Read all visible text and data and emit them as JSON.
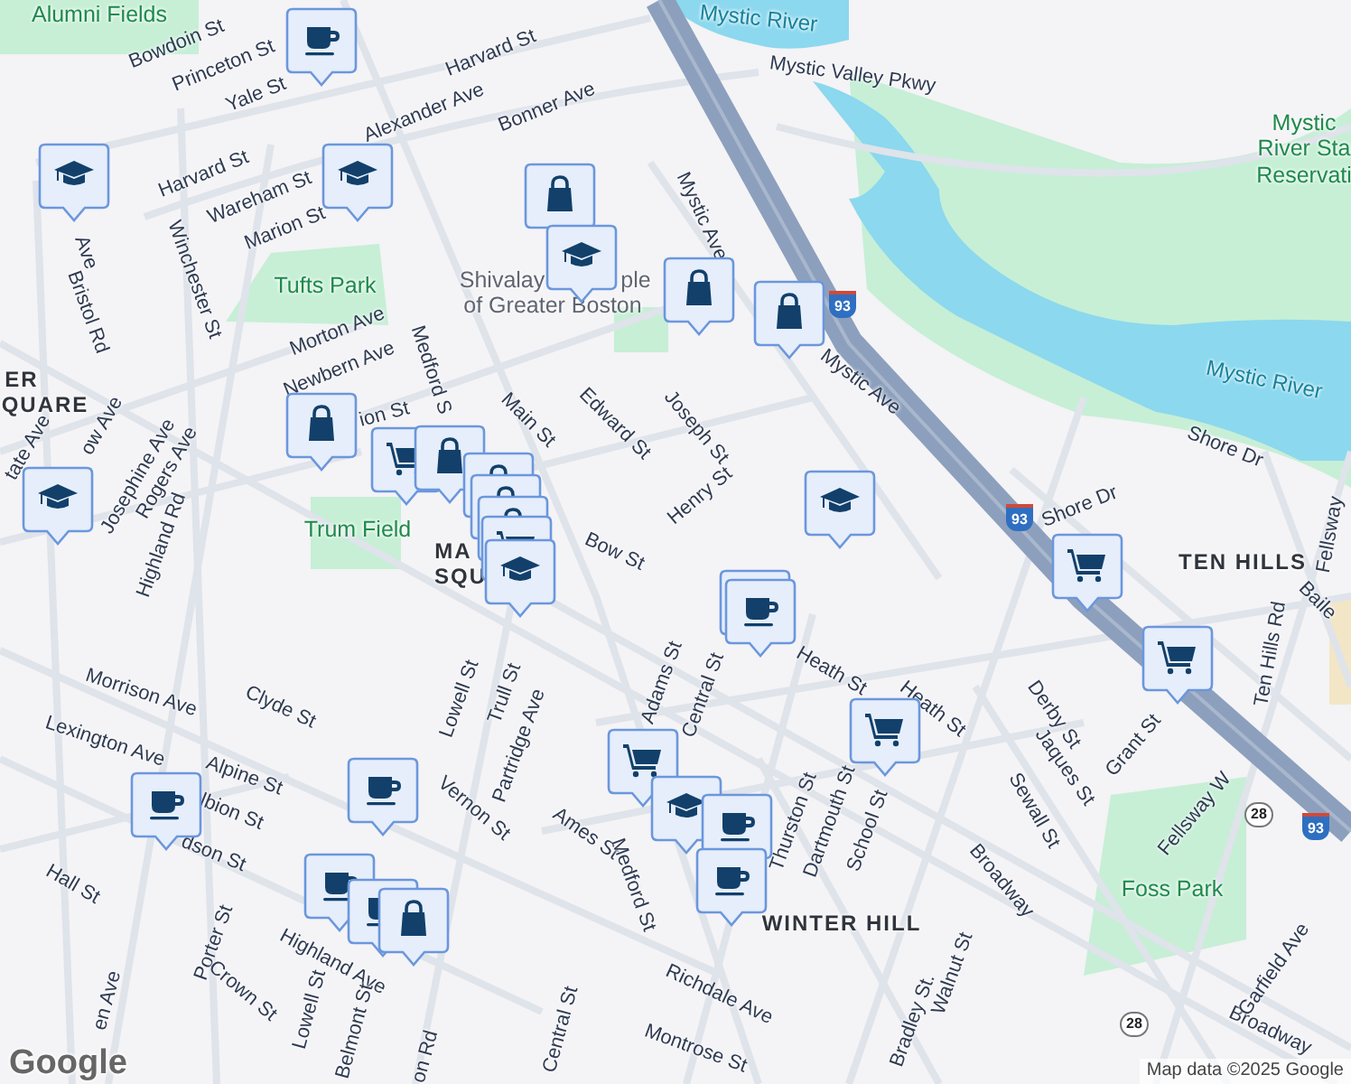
{
  "map": {
    "labels": [
      {
        "text": "Alumni Fields",
        "kind": "park"
      },
      {
        "text": "Bowdoin St",
        "kind": "street"
      },
      {
        "text": "Princeton St",
        "kind": "street"
      },
      {
        "text": "Yale St",
        "kind": "street"
      },
      {
        "text": "Harvard St",
        "kind": "street"
      },
      {
        "text": "Alexander Ave",
        "kind": "street"
      },
      {
        "text": "Bonner Ave",
        "kind": "street"
      },
      {
        "text": "Harvard St",
        "kind": "street"
      },
      {
        "text": "Wareham St",
        "kind": "street"
      },
      {
        "text": "Marion St",
        "kind": "street"
      },
      {
        "text": "Winchester St",
        "kind": "street"
      },
      {
        "text": "Bristol Rd",
        "kind": "street"
      },
      {
        "text": "Ave",
        "kind": "street"
      },
      {
        "text": "Tufts Park",
        "kind": "park"
      },
      {
        "text": "Shivalay",
        "kind": "poi"
      },
      {
        "text": "ple",
        "kind": "poi"
      },
      {
        "text": "of Greater Boston",
        "kind": "poi"
      },
      {
        "text": "Morton Ave",
        "kind": "street"
      },
      {
        "text": "Newbern Ave",
        "kind": "street"
      },
      {
        "text": "Medford S",
        "kind": "street"
      },
      {
        "text": "ion St",
        "kind": "street"
      },
      {
        "text": "Main St",
        "kind": "street"
      },
      {
        "text": "Edward St",
        "kind": "street"
      },
      {
        "text": "Joseph St",
        "kind": "street"
      },
      {
        "text": "Henry St",
        "kind": "street"
      },
      {
        "text": "Mystic Ave",
        "kind": "street"
      },
      {
        "text": "Mystic Ave",
        "kind": "street"
      },
      {
        "text": "Mystic River",
        "kind": "water"
      },
      {
        "text": "Mystic Valley Pkwy",
        "kind": "street"
      },
      {
        "text": "Mystic",
        "kind": "park"
      },
      {
        "text": "River Sta",
        "kind": "park"
      },
      {
        "text": "Reservati",
        "kind": "park"
      },
      {
        "text": "Mystic River",
        "kind": "water"
      },
      {
        "text": "Shore Dr",
        "kind": "street"
      },
      {
        "text": "Shore Dr",
        "kind": "street"
      },
      {
        "text": "TEN HILLS",
        "kind": "area"
      },
      {
        "text": "Baile",
        "kind": "street"
      },
      {
        "text": "Ten Hills Rd",
        "kind": "street"
      },
      {
        "text": "Fellsway",
        "kind": "street"
      },
      {
        "text": "ER",
        "kind": "area"
      },
      {
        "text": "QUARE",
        "kind": "area"
      },
      {
        "text": "tate Ave",
        "kind": "street"
      },
      {
        "text": "ow Ave",
        "kind": "street"
      },
      {
        "text": "Josephine Ave",
        "kind": "street"
      },
      {
        "text": "Rogers Ave",
        "kind": "street"
      },
      {
        "text": "Highland Rd",
        "kind": "street"
      },
      {
        "text": "Trum Field",
        "kind": "park"
      },
      {
        "text": "MA",
        "kind": "area"
      },
      {
        "text": "SQU",
        "kind": "area"
      },
      {
        "text": "Bow St",
        "kind": "street"
      },
      {
        "text": "Morrison Ave",
        "kind": "street"
      },
      {
        "text": "Clyde St",
        "kind": "street"
      },
      {
        "text": "Lexington Ave",
        "kind": "street"
      },
      {
        "text": "Alpine St",
        "kind": "street"
      },
      {
        "text": "lbion St",
        "kind": "street"
      },
      {
        "text": "dson St",
        "kind": "street"
      },
      {
        "text": "Hall St",
        "kind": "street"
      },
      {
        "text": "Lowell St",
        "kind": "street"
      },
      {
        "text": "Trull St",
        "kind": "street"
      },
      {
        "text": "Partridge Ave",
        "kind": "street"
      },
      {
        "text": "Vernon St",
        "kind": "street"
      },
      {
        "text": "Ames St",
        "kind": "street"
      },
      {
        "text": "Adams St",
        "kind": "street"
      },
      {
        "text": "Central St",
        "kind": "street"
      },
      {
        "text": "Medford St",
        "kind": "street"
      },
      {
        "text": "Heath St",
        "kind": "street"
      },
      {
        "text": "Heath St",
        "kind": "street"
      },
      {
        "text": "Thurston St",
        "kind": "street"
      },
      {
        "text": "Dartmouth St",
        "kind": "street"
      },
      {
        "text": "School St",
        "kind": "street"
      },
      {
        "text": "Derby St",
        "kind": "street"
      },
      {
        "text": "Jaques St",
        "kind": "street"
      },
      {
        "text": "Sewall St",
        "kind": "street"
      },
      {
        "text": "Grant St",
        "kind": "street"
      },
      {
        "text": "Fellsway W",
        "kind": "street"
      },
      {
        "text": "Broadway",
        "kind": "street"
      },
      {
        "text": "Broadway",
        "kind": "street"
      },
      {
        "text": "Foss Park",
        "kind": "park"
      },
      {
        "text": "WINTER HILL",
        "kind": "area"
      },
      {
        "text": "Walnut St",
        "kind": "street"
      },
      {
        "text": "Bradley St.",
        "kind": "street"
      },
      {
        "text": "Garfield Ave",
        "kind": "street"
      },
      {
        "text": "Highland Ave",
        "kind": "street"
      },
      {
        "text": "Porter St",
        "kind": "street"
      },
      {
        "text": "Crown St",
        "kind": "street"
      },
      {
        "text": "Lowell St",
        "kind": "street"
      },
      {
        "text": "Belmont St",
        "kind": "street"
      },
      {
        "text": "en Ave",
        "kind": "street"
      },
      {
        "text": "on Rd",
        "kind": "street"
      },
      {
        "text": "Central St",
        "kind": "street"
      },
      {
        "text": "Richdale Ave",
        "kind": "street"
      },
      {
        "text": "Montrose St",
        "kind": "street"
      }
    ],
    "shields": [
      {
        "text": "93",
        "kind": "interstate"
      },
      {
        "text": "93",
        "kind": "interstate"
      },
      {
        "text": "93",
        "kind": "interstate"
      },
      {
        "text": "28",
        "kind": "state"
      },
      {
        "text": "28",
        "kind": "state"
      }
    ],
    "markers": [
      {
        "kind": "coffee"
      },
      {
        "kind": "school"
      },
      {
        "kind": "school"
      },
      {
        "kind": "shop"
      },
      {
        "kind": "school"
      },
      {
        "kind": "shop"
      },
      {
        "kind": "shop"
      },
      {
        "kind": "shop"
      },
      {
        "kind": "cart"
      },
      {
        "kind": "shop"
      },
      {
        "kind": "shop"
      },
      {
        "kind": "shop"
      },
      {
        "kind": "shop"
      },
      {
        "kind": "cart"
      },
      {
        "kind": "school"
      },
      {
        "kind": "school"
      },
      {
        "kind": "school"
      },
      {
        "kind": "cart"
      },
      {
        "kind": "shop"
      },
      {
        "kind": "coffee"
      },
      {
        "kind": "cart"
      },
      {
        "kind": "cart"
      },
      {
        "kind": "cart"
      },
      {
        "kind": "school"
      },
      {
        "kind": "coffee"
      },
      {
        "kind": "coffee"
      },
      {
        "kind": "coffee"
      },
      {
        "kind": "coffee"
      },
      {
        "kind": "coffee"
      },
      {
        "kind": "coffee"
      },
      {
        "kind": "shop"
      }
    ]
  },
  "logo": "Google",
  "attribution": "Map data ©2025 Google"
}
